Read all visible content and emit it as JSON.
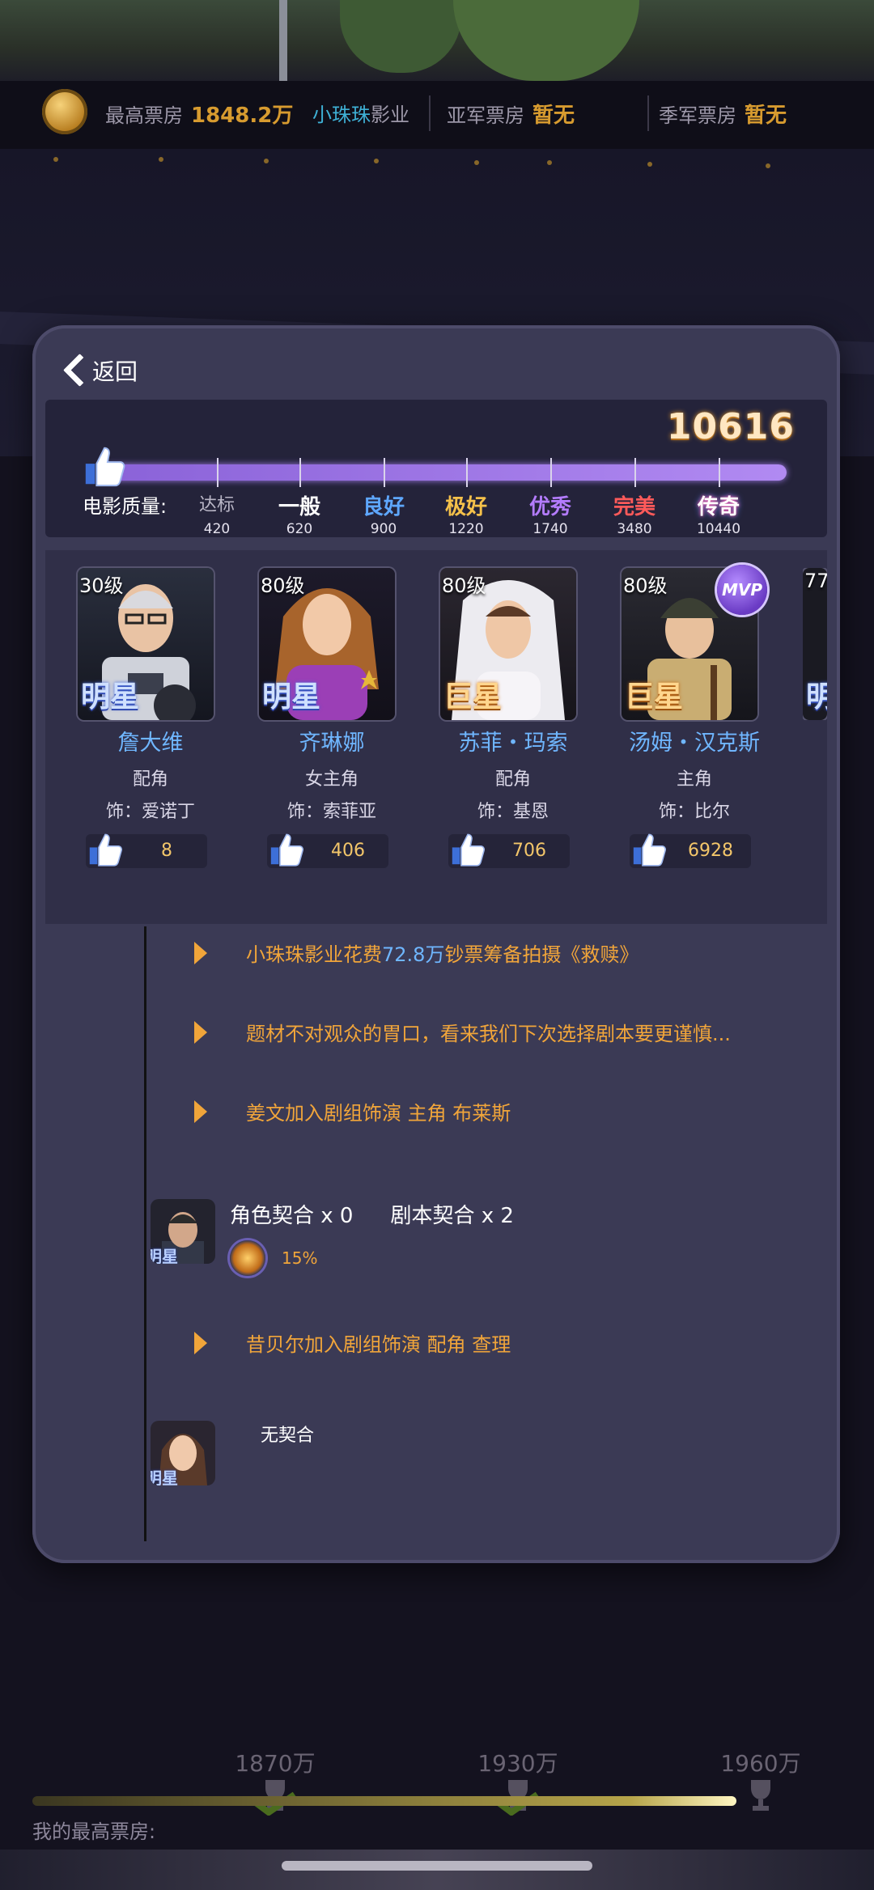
{
  "stats": {
    "best_label": "最高票房",
    "best_value": "1848.2万",
    "studio_a": "小珠珠",
    "studio_b": "影业",
    "second_label": "亚军票房",
    "second_value": "暂无",
    "third_label": "季军票房",
    "third_value": "暂无"
  },
  "panel": {
    "back_label": "返回",
    "score": "10616",
    "quality_label": "电影质量:",
    "quality_level_fraction": 1.0,
    "tiers": [
      {
        "name": "达标",
        "value": "420",
        "color": "#b9b6c6"
      },
      {
        "name": "一般",
        "value": "620",
        "color": "#ffffff"
      },
      {
        "name": "良好",
        "value": "900",
        "color": "#5ea7ff"
      },
      {
        "name": "极好",
        "value": "1220",
        "color": "#f5c14a"
      },
      {
        "name": "优秀",
        "value": "1740",
        "color": "#b47cff"
      },
      {
        "name": "完美",
        "value": "3480",
        "color": "#ff5a5a"
      },
      {
        "name": "传奇",
        "value": "10440",
        "color": "#ffffff"
      }
    ]
  },
  "cast": [
    {
      "level": "30级",
      "rank": "明星",
      "rank_type": "star",
      "name": "詹大维",
      "role": "配角",
      "plays": "饰：爱诺丁",
      "likes": "8"
    },
    {
      "level": "80级",
      "rank": "明星",
      "rank_type": "star",
      "name": "齐琳娜",
      "role": "女主角",
      "plays": "饰：索菲亚",
      "likes": "406"
    },
    {
      "level": "80级",
      "rank": "巨星",
      "rank_type": "super",
      "name": "苏菲・玛索",
      "role": "配角",
      "plays": "饰：基恩",
      "likes": "706"
    },
    {
      "level": "80级",
      "rank": "巨星",
      "rank_type": "super",
      "name": "汤姆・汉克斯",
      "role": "主角",
      "plays": "饰：比尔",
      "likes": "6928",
      "badge": "MVP"
    },
    {
      "level": "77",
      "rank": "明",
      "rank_type": "star"
    }
  ],
  "events": {
    "e1_pre": "小珠珠影业花费",
    "e1_amount": "72.8万",
    "e1_post": "钞票筹备拍摄《救赎》",
    "e2": "题材不对观众的胃口，看来我们下次选择剧本要更谨慎...",
    "e3": "姜文加入剧组饰演 主角 布莱斯",
    "s1_role": "角色契合 x 0",
    "s1_script": "剧本契合 x 2",
    "s1_percent": "15%",
    "s1_tag": "明星",
    "e4": "昔贝尔加入剧组饰演 配角 查理",
    "s2_text": "无契合",
    "s2_tag": "明星"
  },
  "bottom": {
    "milestones": [
      "1870万",
      "1930万",
      "1960万"
    ],
    "my_best_label": "我的最高票房:"
  },
  "colors": {
    "accent_orange": "#f1a53a",
    "accent_blue": "#6fb6ff",
    "panel_bg": "#3b3a55",
    "progress_purple": "#a07be8"
  }
}
